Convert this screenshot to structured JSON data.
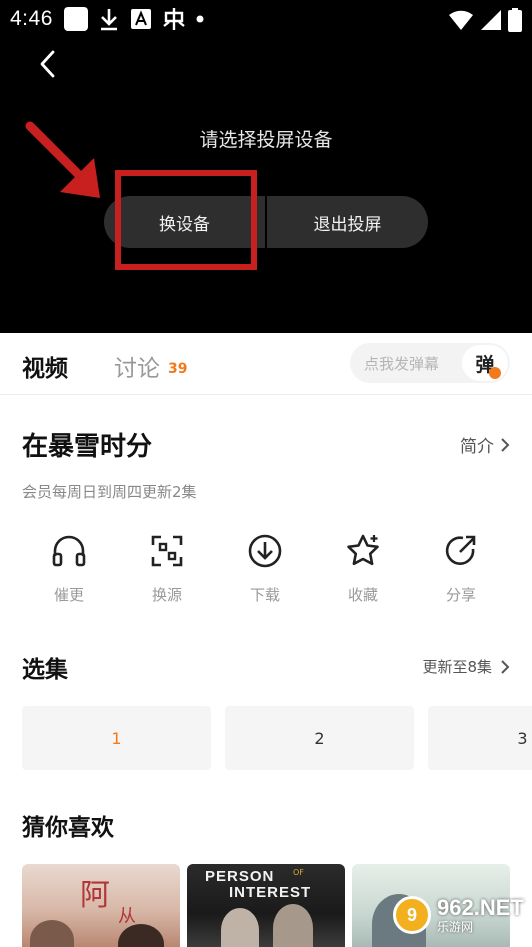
{
  "status_bar": {
    "time": "4:46"
  },
  "player": {
    "cast_title": "请选择投屏设备",
    "switch_device_label": "换设备",
    "exit_cast_label": "退出投屏",
    "annotation_color": "#c8201e"
  },
  "tabs": {
    "video_label": "视频",
    "comment_label": "讨论",
    "comment_count": "39",
    "danmu_placeholder": "点我发弹幕",
    "danmu_toggle_label": "弹"
  },
  "show": {
    "title": "在暴雪时分",
    "intro_label": "简介",
    "update_info": "会员每周日到周四更新2集"
  },
  "actions": [
    {
      "label": "催更",
      "icon": "headphones-icon"
    },
    {
      "label": "换源",
      "icon": "switch-source-icon"
    },
    {
      "label": "下载",
      "icon": "download-icon"
    },
    {
      "label": "收藏",
      "icon": "star-icon"
    },
    {
      "label": "分享",
      "icon": "share-icon"
    }
  ],
  "episodes": {
    "title": "选集",
    "more_label": "更新至8集",
    "items": [
      "1",
      "2",
      "3"
    ],
    "active": "1",
    "accent_color": "#f07a1c"
  },
  "recommend": {
    "title": "猜你喜欢",
    "posters": [
      {
        "line1": "阿",
        "line2": "从"
      },
      {
        "line1": "PERSON",
        "of": "OF",
        "line2": "INTEREST"
      },
      {}
    ]
  },
  "watermark": {
    "logo": "9",
    "main": "962.NET",
    "sub": "乐游网"
  }
}
